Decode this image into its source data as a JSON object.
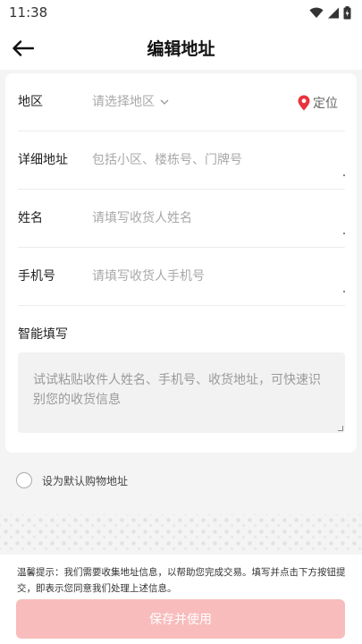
{
  "status_bar": {
    "time": "11:38",
    "icons": [
      "wifi-icon",
      "signal-icon",
      "battery-icon"
    ]
  },
  "header": {
    "title": "编辑地址",
    "back_icon": "back-arrow-icon"
  },
  "form": {
    "region": {
      "label": "地区",
      "placeholder": "请选择地区",
      "locate_label": "定位"
    },
    "detail_address": {
      "label": "详细地址",
      "placeholder": "包括小区、楼栋号、门牌号"
    },
    "name": {
      "label": "姓名",
      "placeholder": "请填写收货人姓名"
    },
    "phone": {
      "label": "手机号",
      "placeholder": "请填写收货人手机号"
    },
    "smart_fill": {
      "label": "智能填写",
      "placeholder": "试试粘贴收件人姓名、手机号、收货地址，可快速识别您的收货信息"
    },
    "default_address": {
      "label": "设为默认购物地址",
      "checked": false
    }
  },
  "footer": {
    "notice": "温馨提示：我们需要收集地址信息，以帮助您完成交易。填写并点击下方按钮提交，即表示您同意我们处理上述信息。",
    "save_button": "保存并使用"
  },
  "colors": {
    "accent": "#e8333e",
    "save_button_bg": "#f8bcbc",
    "page_bg": "#f4f4f4"
  }
}
